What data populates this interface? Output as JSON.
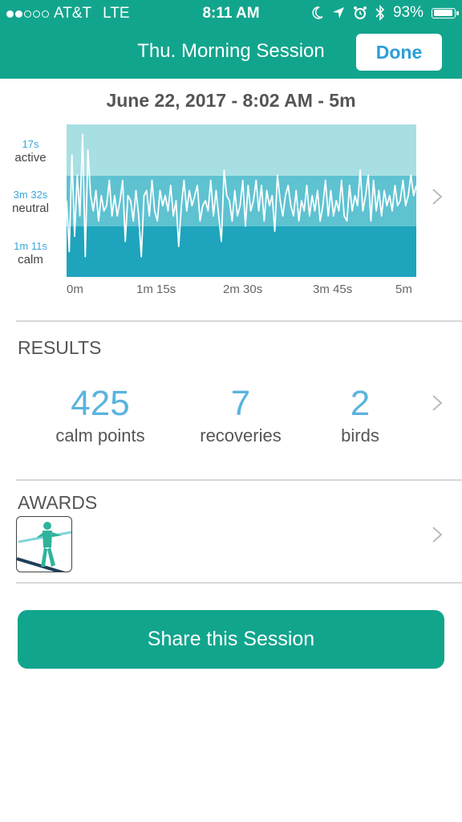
{
  "status_bar": {
    "carrier": "AT&T",
    "network": "LTE",
    "time": "8:11 AM",
    "battery": "93%",
    "signal_bars_filled": 2,
    "signal_bars_total": 5
  },
  "nav": {
    "title": "Thu. Morning Session",
    "done_label": "Done"
  },
  "session": {
    "date_line": "June 22, 2017 - 8:02 AM - 5m"
  },
  "chart": {
    "bands": [
      {
        "duration": "17s",
        "name": "active"
      },
      {
        "duration": "3m 32s",
        "name": "neutral"
      },
      {
        "duration": "1m 11s",
        "name": "calm"
      }
    ],
    "x_ticks": [
      "0m",
      "1m 15s",
      "2m 30s",
      "3m 45s",
      "5m"
    ]
  },
  "chart_data": {
    "type": "line",
    "x_range": [
      0,
      300
    ],
    "y_range": [
      0,
      3
    ],
    "x_unit": "seconds",
    "series": [
      {
        "values": [
          1.5,
          0.5,
          2.4,
          0.8,
          2.0,
          1.2,
          2.8,
          0.4,
          2.5,
          1.6,
          1.3,
          1.7,
          1.1,
          1.6,
          1.3,
          1.4,
          1.9,
          1.2,
          1.6,
          1.2,
          1.5,
          1.9,
          0.7,
          1.6,
          1.5,
          1.1,
          1.7,
          1.2,
          0.4,
          1.6,
          1.7,
          1.2,
          1.9,
          1.3,
          1.1,
          1.7,
          1.4,
          1.6,
          1.3,
          1.8,
          1.2,
          1.5,
          0.6,
          1.4,
          1.9,
          1.3,
          1.7,
          1.4,
          1.6,
          1.8,
          1.1,
          1.4,
          1.5,
          1.3,
          1.9,
          1.2,
          1.7,
          1.2,
          0.7,
          2.1,
          1.6,
          1.5,
          1.1,
          1.7,
          1.2,
          1.4,
          1.9,
          1.0,
          1.8,
          1.3,
          1.5,
          1.9,
          1.3,
          1.8,
          1.1,
          1.7,
          1.4,
          1.6,
          0.9,
          2.0,
          1.5,
          1.2,
          1.6,
          1.8,
          1.4,
          1.2,
          1.7,
          1.1,
          1.5,
          1.3,
          1.8,
          1.2,
          1.6,
          1.3,
          1.7,
          1.1,
          1.4,
          1.9,
          1.2,
          1.7,
          1.2,
          1.5,
          1.3,
          1.9,
          1.2,
          1.1,
          1.8,
          1.3,
          1.6,
          1.4,
          2.1,
          1.3,
          1.6,
          2.0,
          1.1,
          1.9,
          1.3,
          1.7,
          1.2,
          1.7,
          1.4,
          1.6,
          1.3,
          1.8,
          1.4,
          1.5,
          1.9,
          1.4,
          1.6,
          2.0,
          1.6,
          1.8
        ]
      }
    ],
    "annotations": [
      "active",
      "neutral",
      "calm"
    ]
  },
  "results": {
    "title": "RESULTS",
    "stats": [
      {
        "value": "425",
        "label": "calm points"
      },
      {
        "value": "7",
        "label": "recoveries"
      },
      {
        "value": "2",
        "label": "birds"
      }
    ]
  },
  "awards": {
    "title": "AWARDS",
    "badge_icon": "tightrope-walker-icon"
  },
  "share": {
    "label": "Share this Session"
  },
  "colors": {
    "brand_green": "#12a58d",
    "accent_blue": "#5ab3de",
    "band_active": "#a8dfe3",
    "band_neutral": "#5ec2d1",
    "band_calm": "#1ea4bd"
  }
}
